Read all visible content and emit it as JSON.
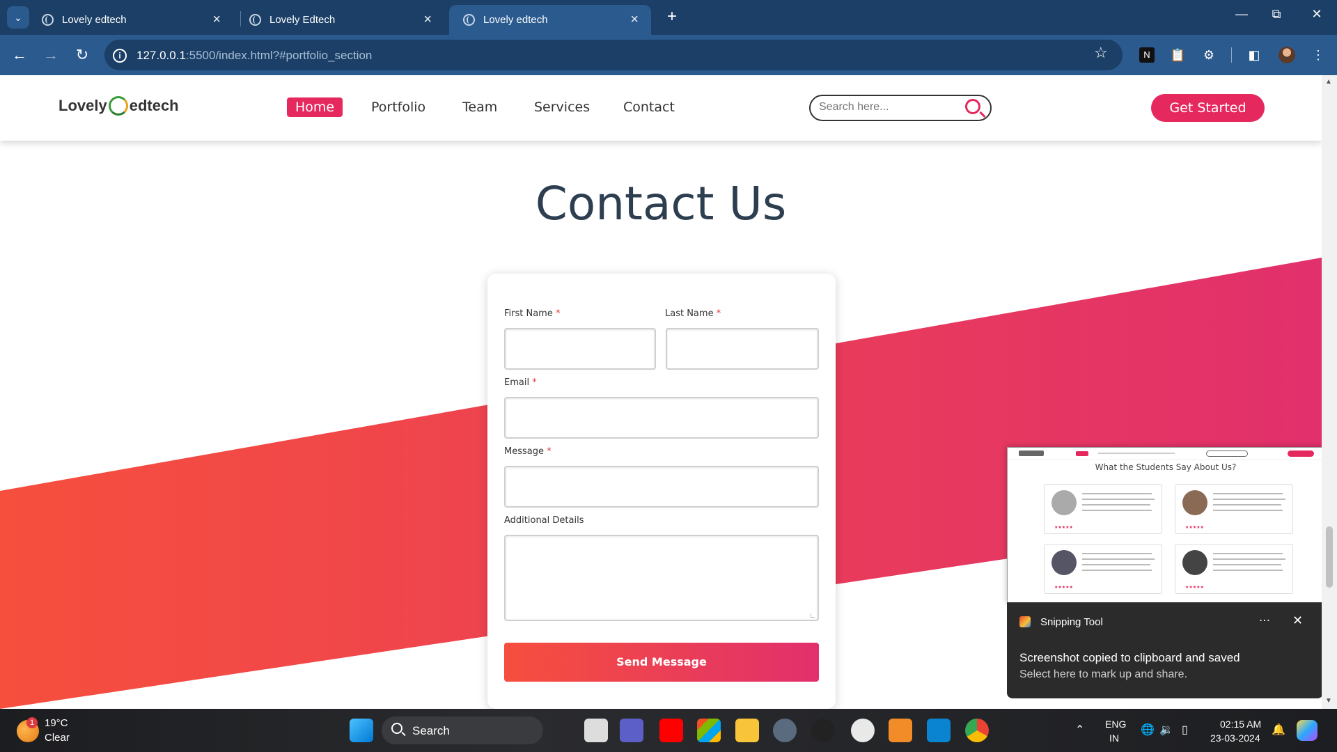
{
  "browser": {
    "tabs": [
      {
        "title": "Lovely edtech",
        "active": false
      },
      {
        "title": "Lovely Edtech",
        "active": false
      },
      {
        "title": "Lovely edtech",
        "active": true
      }
    ],
    "url_host": "127.0.0.1",
    "url_rest": ":5500/index.html?#portfolio_section"
  },
  "site": {
    "logo_left": "Lovely",
    "logo_right": "edtech",
    "nav": [
      "Home",
      "Portfolio",
      "Team",
      "Services",
      "Contact"
    ],
    "search_placeholder": "Search here...",
    "cta": "Get Started",
    "heading": "Contact Us",
    "form": {
      "first_name": "First Name",
      "last_name": "Last Name",
      "email": "Email",
      "message": "Message",
      "additional": "Additional Details",
      "required_mark": "*",
      "submit": "Send Message"
    },
    "colors": {
      "accent": "#e5295e",
      "gradient_start": "#f64f3d",
      "gradient_end": "#e1306c"
    }
  },
  "preview": {
    "title": "What the Students Say About Us?"
  },
  "toast": {
    "app": "Snipping Tool",
    "message": "Screenshot copied to clipboard and saved",
    "sub": "Select here to mark up and share."
  },
  "taskbar": {
    "weather_badge": "1",
    "temperature": "19°C",
    "condition": "Clear",
    "search": "Search",
    "lang_top": "ENG",
    "lang_bottom": "IN",
    "time": "02:15 AM",
    "date": "23-03-2024"
  }
}
